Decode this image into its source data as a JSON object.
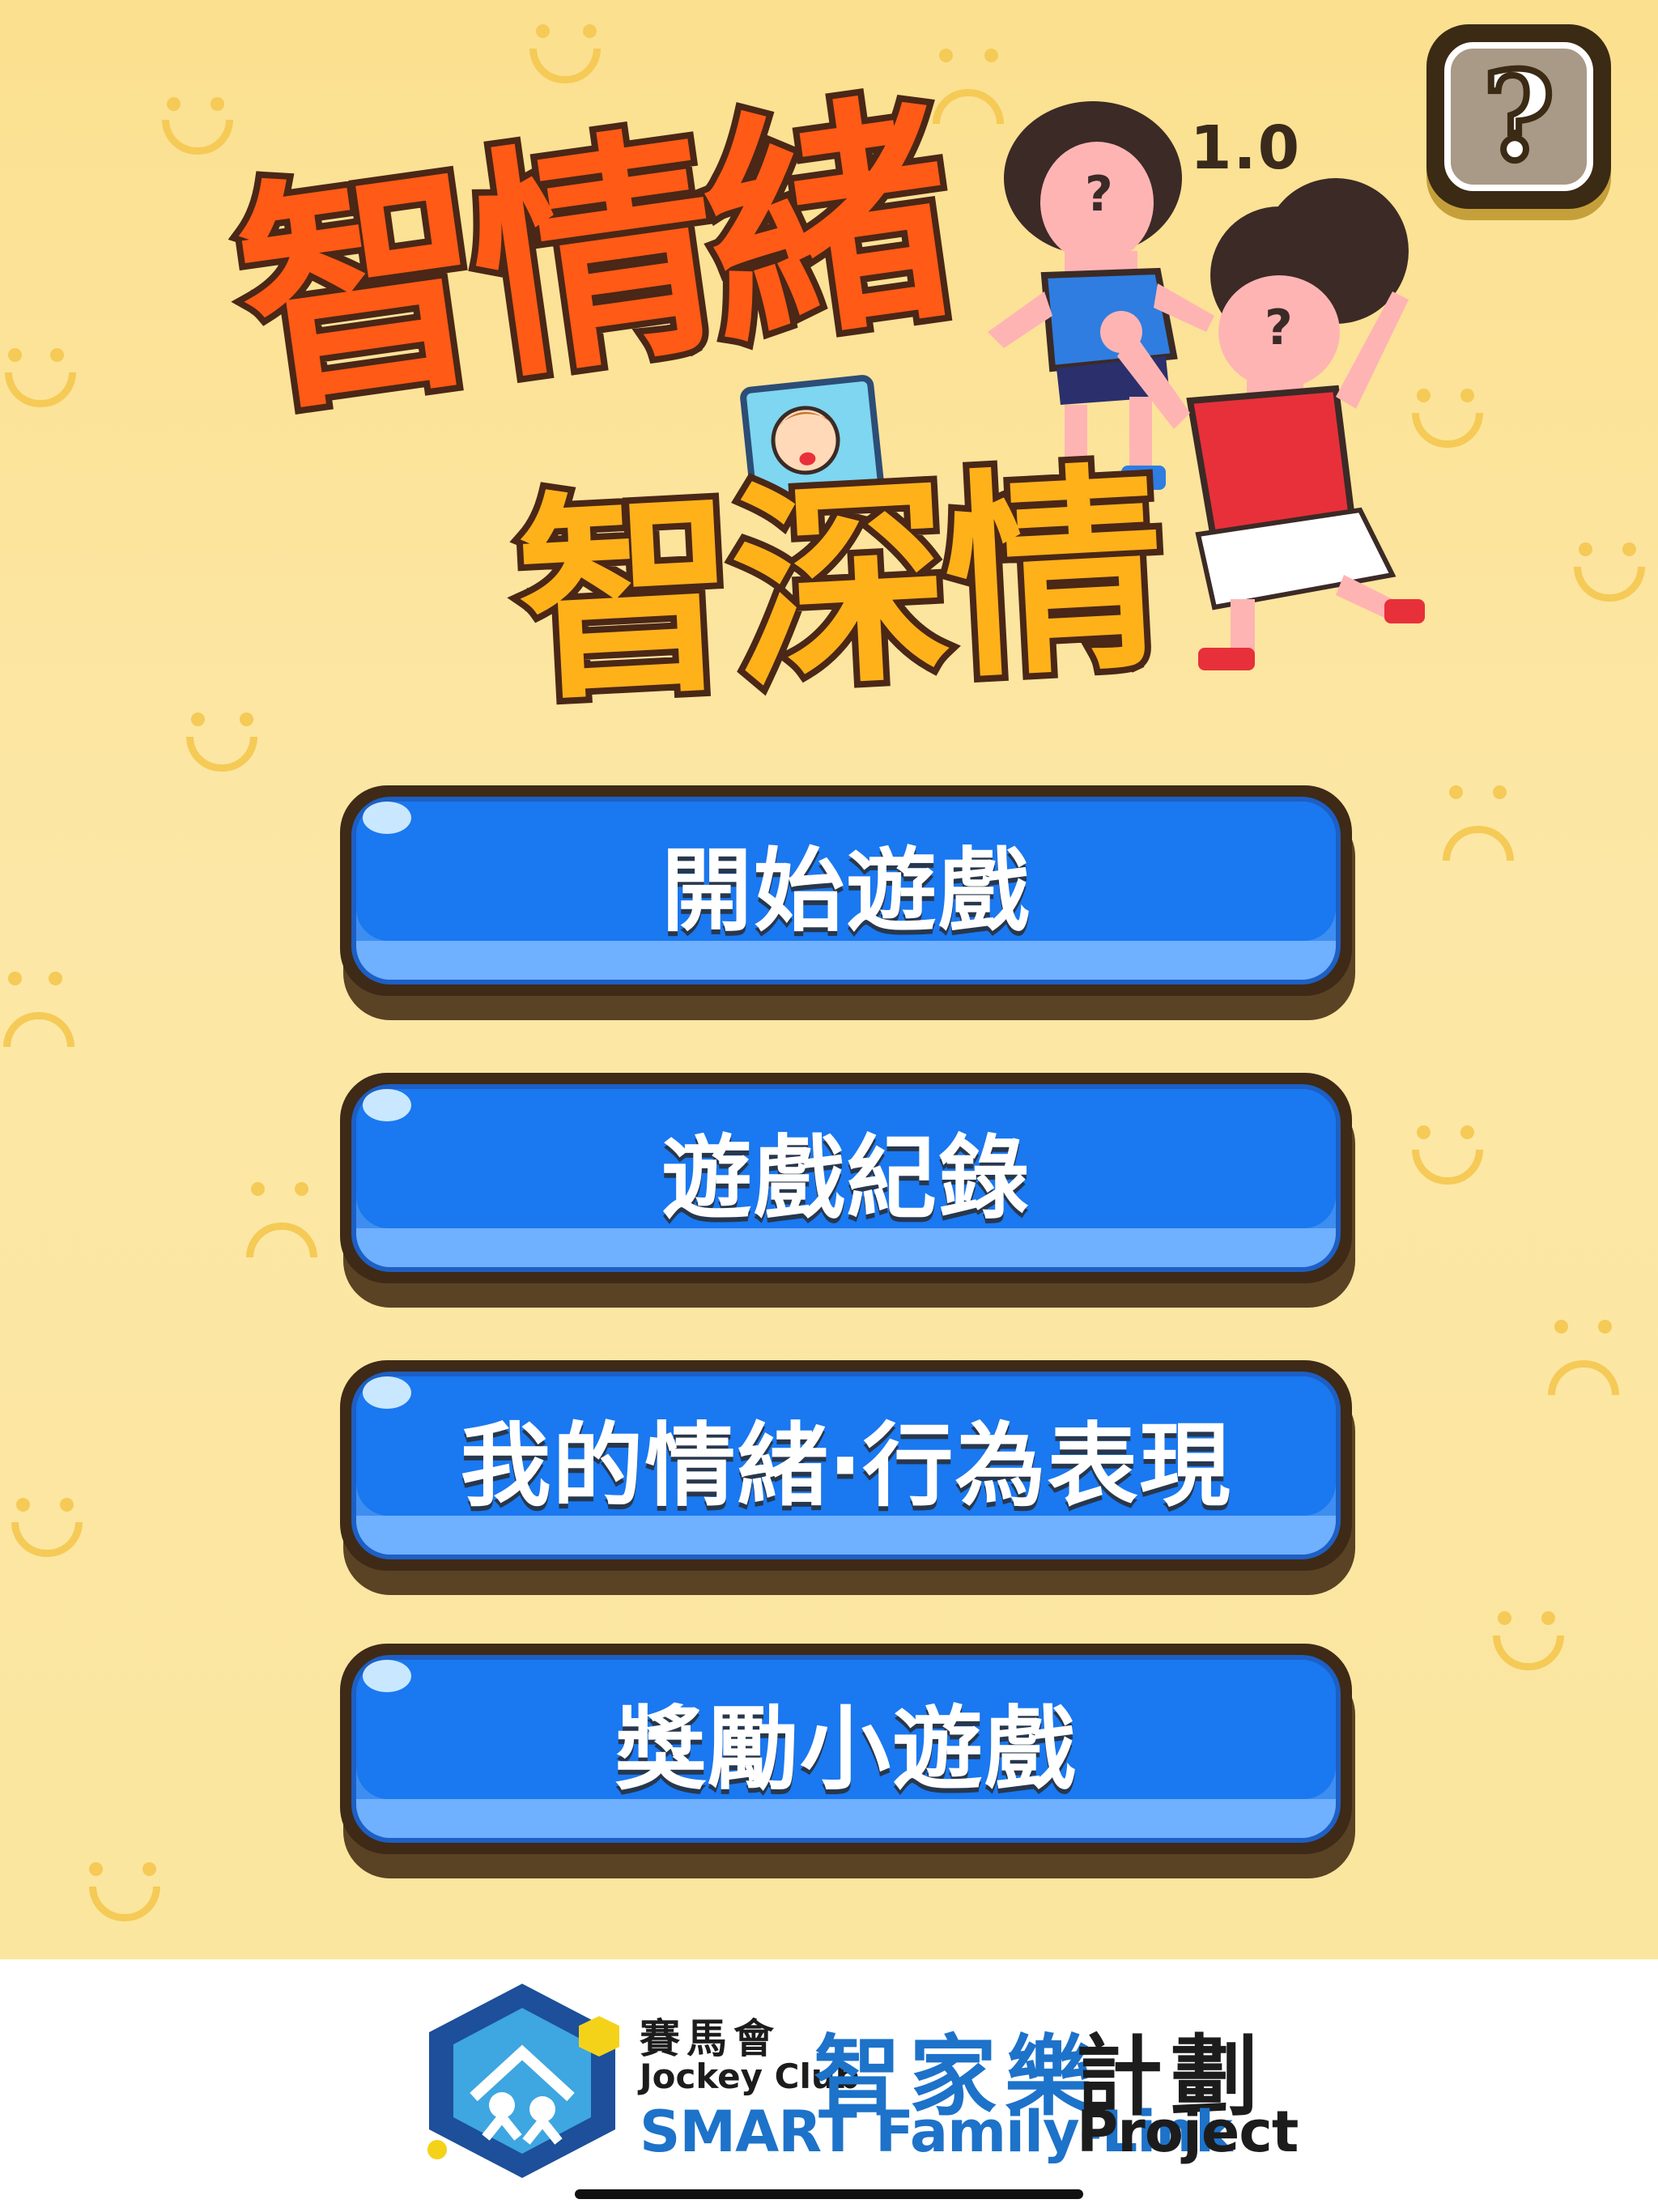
{
  "app": {
    "version": "1.0",
    "help_icon": "question-mark-icon",
    "title_line1": "智情緒",
    "title_line2": "智深情"
  },
  "menu": {
    "buttons": [
      {
        "label": "開始遊戲"
      },
      {
        "label": "遊戲紀錄"
      },
      {
        "label": "我的情緒‧行為表現"
      },
      {
        "label": "獎勵小遊戲"
      }
    ]
  },
  "footer": {
    "sponsor_cn": "賽馬會",
    "sponsor_en": "Jockey Club",
    "program_cn_highlight": "智家樂",
    "program_cn_rest": "計劃",
    "program_en_highlight": "SMART Family-Link",
    "program_en_rest": "Project"
  },
  "colors": {
    "background": "#fbe08f",
    "button_blue": "#1a78f0",
    "title_orange": "#ff5a16",
    "title_yellow": "#ffb11a",
    "footer_blue": "#1d72c9"
  }
}
